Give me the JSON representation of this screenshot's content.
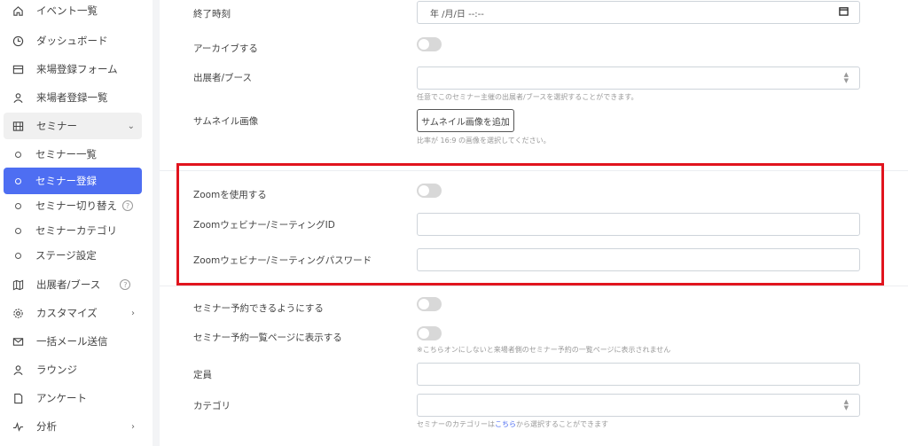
{
  "sidebar": {
    "items": [
      {
        "label": "イベント一覧",
        "icon": "home-icon"
      },
      {
        "label": "ダッシュボード",
        "icon": "clock-icon"
      },
      {
        "label": "来場登録フォーム",
        "icon": "form-icon"
      },
      {
        "label": "来場者登録一覧",
        "icon": "user-icon"
      },
      {
        "label": "セミナー",
        "icon": "film-icon"
      },
      {
        "label": "セミナー一覧"
      },
      {
        "label": "セミナー登録"
      },
      {
        "label": "セミナー切り替え"
      },
      {
        "label": "セミナーカテゴリ"
      },
      {
        "label": "ステージ設定"
      },
      {
        "label": "出展者/ブース",
        "icon": "map-icon"
      },
      {
        "label": "カスタマイズ",
        "icon": "gear-icon"
      },
      {
        "label": "一括メール送信",
        "icon": "mail-icon"
      },
      {
        "label": "ラウンジ",
        "icon": "user-icon"
      },
      {
        "label": "アンケート",
        "icon": "document-icon"
      },
      {
        "label": "分析",
        "icon": "pulse-icon"
      }
    ],
    "help_glyph": "?"
  },
  "form": {
    "end_time_label": "終了時刻",
    "end_time_placeholder": "年 /月/日 --:--",
    "archive_label": "アーカイブする",
    "exhibitor_label": "出展者/ブース",
    "exhibitor_hint": "任意でこのセミナー主催の出展者/ブースを選択することができます。",
    "thumbnail_label": "サムネイル画像",
    "thumbnail_button": "サムネイル画像を追加",
    "thumbnail_hint": "比率が 16:9 の画像を選択してください。",
    "zoom_use_label": "Zoomを使用する",
    "zoom_id_label": "Zoomウェビナー/ミーティングID",
    "zoom_password_label": "Zoomウェビナー/ミーティングパスワード",
    "reservation_label": "セミナー予約できるようにする",
    "reservation_list_label": "セミナー予約一覧ページに表示する",
    "reservation_list_hint": "※こちらオンにしないと来場者側のセミナー予約の一覧ページに表示されません",
    "capacity_label": "定員",
    "category_label": "カテゴリ",
    "category_hint_before": "セミナーのカテゴリーは",
    "category_hint_link": "こちら",
    "category_hint_after": "から選択することができます"
  },
  "colors": {
    "accent": "#4e6ef2",
    "highlight": "#e1141e"
  }
}
